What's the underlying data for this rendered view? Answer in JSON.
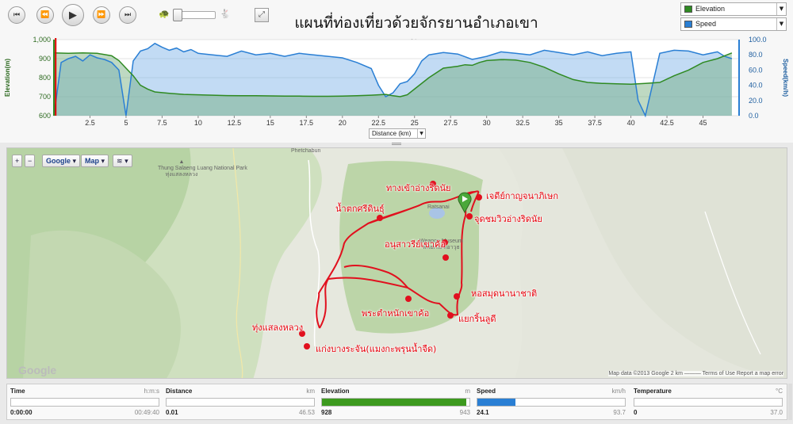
{
  "title": "แผนที่ท่องเที่ยวด้วยจักรยานอำเภอเขาค้อ",
  "controls": {
    "skip_back_icon": "skip-to-start-icon",
    "step_back_icon": "step-back-icon",
    "play_icon": "play-icon",
    "step_forward_icon": "step-forward-icon",
    "skip_forward_icon": "skip-to-end-icon",
    "slow_icon": "turtle-icon",
    "fast_icon": "rabbit-icon",
    "playback_speed": 0.05,
    "fullscreen_icon": "fullscreen-icon"
  },
  "selectors": [
    {
      "label": "Elevation",
      "color": "#2f8a22"
    },
    {
      "label": "Speed",
      "color": "#2a7fd4"
    }
  ],
  "chart_data": {
    "type": "area",
    "x_label_select": "Distance (km)",
    "xlim": [
      0,
      47.5
    ],
    "x_ticks": [
      "2.5",
      "5",
      "7.5",
      "10",
      "12.5",
      "15",
      "17.5",
      "20",
      "22.5",
      "25",
      "27.5",
      "30",
      "32.5",
      "35",
      "37.5",
      "40",
      "42.5",
      "45"
    ],
    "y_left_label": "Elevation(m)",
    "y_left_ticks": [
      "1,000",
      "900",
      "800",
      "700",
      "600"
    ],
    "y_left_range": [
      600,
      1000
    ],
    "y_right_label": "Speed(km/h)",
    "y_right_ticks": [
      "100.0",
      "80.0",
      "60.0",
      "40.0",
      "20.0",
      "0.0"
    ],
    "y_right_range": [
      0,
      100
    ],
    "cursor_x": 0.01,
    "series": [
      {
        "name": "Elevation",
        "color": "#2f8a22",
        "x": [
          0,
          1,
          2,
          3,
          4,
          4.5,
          5,
          5.5,
          6,
          6.5,
          7,
          8,
          9,
          10,
          11,
          12,
          13,
          14,
          15,
          16,
          17,
          18,
          19,
          20,
          21,
          22,
          23,
          23.5,
          24,
          24.5,
          25,
          26,
          27,
          28,
          28.5,
          29,
          29.5,
          30,
          31,
          32,
          33,
          34,
          35,
          36,
          37,
          38,
          39,
          40,
          41,
          42,
          43,
          44,
          45,
          46,
          47
        ],
        "y": [
          930,
          928,
          930,
          928,
          915,
          890,
          850,
          810,
          760,
          740,
          725,
          718,
          712,
          710,
          708,
          706,
          705,
          705,
          704,
          703,
          703,
          702,
          702,
          703,
          705,
          708,
          712,
          705,
          700,
          710,
          740,
          800,
          850,
          860,
          868,
          865,
          880,
          890,
          895,
          893,
          880,
          855,
          820,
          790,
          775,
          770,
          768,
          766,
          770,
          775,
          810,
          840,
          880,
          900,
          930
        ]
      },
      {
        "name": "Speed",
        "color": "#2a7fd4",
        "x": [
          0,
          0.5,
          1,
          1.5,
          2,
          2.5,
          3,
          3.5,
          4,
          4.5,
          5,
          5.5,
          6,
          6.5,
          7,
          7.5,
          8,
          8.5,
          9,
          9.5,
          10,
          11,
          12,
          13,
          14,
          15,
          16,
          17,
          18,
          19,
          20,
          21,
          22,
          22.5,
          23,
          23.5,
          24,
          24.5,
          25,
          25.5,
          26,
          27,
          28,
          29,
          30,
          31,
          32,
          33,
          34,
          35,
          36,
          37,
          38,
          39,
          40,
          40.5,
          41,
          42,
          43,
          44,
          45,
          46,
          46.5,
          47
        ],
        "y": [
          0,
          70,
          75,
          78,
          72,
          80,
          76,
          74,
          70,
          60,
          0,
          72,
          85,
          88,
          95,
          90,
          86,
          89,
          84,
          87,
          82,
          80,
          78,
          85,
          80,
          82,
          78,
          82,
          80,
          78,
          76,
          70,
          62,
          40,
          25,
          30,
          42,
          45,
          55,
          72,
          80,
          83,
          81,
          74,
          78,
          84,
          82,
          80,
          86,
          83,
          80,
          84,
          79,
          82,
          84,
          20,
          0,
          82,
          86,
          85,
          80,
          84,
          78,
          75
        ]
      }
    ]
  },
  "map": {
    "zoom_in": "+",
    "zoom_out": "−",
    "google_btn": "Google",
    "map_btn": "Map",
    "layers_icon": "layers-icon",
    "marker_icon": "map-pin-icon",
    "places": {
      "park": "Thung Salaeng Luang National Park",
      "park_th": "ทุ่งแสลงหลวง",
      "phetchabun": "Phetchabun",
      "weapon": "Weapon Museum",
      "weapon_th": "พิพิธภัณฑ์อาวุธ",
      "reservoir": "Ratsanai"
    },
    "labels": [
      "ทางเข้าอ่างริดนัย",
      "เจดีย์กาญจนาภิเษก",
      "จุดชมวิวอ่างริดนัย",
      "น้ำตกศรีดินธุ์",
      "อนุสาวรีย์เขาค้อ",
      "หอสมุดนานาชาติ",
      "ทุ่งแสลงหลวง",
      "พระตำหนักเขาค้อ",
      "แยกริ้นลูดี",
      "แก่งบางระจัน(แมงกะพรุนน้ำจืด)"
    ],
    "google_logo": "Google",
    "footer": "Map data ©2013 Google    2 km ———    Terms of Use    Report a map error"
  },
  "stats": [
    {
      "name": "Time",
      "unit": "h:m:s",
      "current": "0:00:00",
      "max": "00:49:40",
      "fraction": 0,
      "color": "#2a7fd4"
    },
    {
      "name": "Distance",
      "unit": "km",
      "current": "0.01",
      "max": "46.53",
      "fraction": 0,
      "color": "#2a7fd4"
    },
    {
      "name": "Elevation",
      "unit": "m",
      "current": "928",
      "max": "943",
      "fraction": 0.98,
      "color": "#3d9a1f"
    },
    {
      "name": "Speed",
      "unit": "km/h",
      "current": "24.1",
      "max": "93.7",
      "fraction": 0.26,
      "color": "#2a7fd4"
    },
    {
      "name": "Temperature",
      "unit": "°C",
      "current": "0",
      "max": "37.0",
      "fraction": 0,
      "color": "#2a7fd4"
    }
  ]
}
